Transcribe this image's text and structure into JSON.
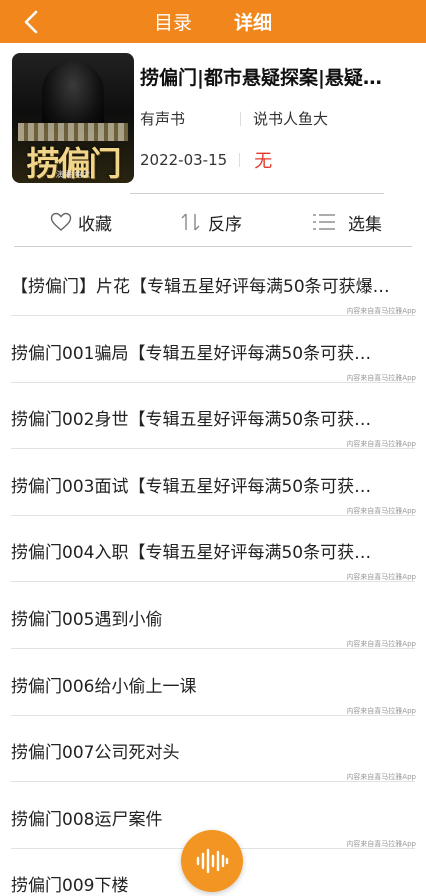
{
  "header": {
    "tabs": [
      "目录",
      "详细"
    ],
    "active_tab": "详细",
    "back_icon": "back-chevron-icon",
    "color": "#f0861c"
  },
  "book": {
    "title": "捞偏门|都市悬疑探案|悬疑…",
    "cover_text": "捞偏门",
    "cover_sub": "演播 鱼大",
    "type": "有声书",
    "narrator": "说书人鱼大",
    "date": "2022-03-15",
    "status": "无"
  },
  "actions": {
    "favorite": "收藏",
    "reverse": "反序",
    "select": "选集"
  },
  "episodes": [
    {
      "title": "【捞偏门】片花【专辑五星好评每满50条可获爆…",
      "source": "内容来自喜马拉雅App"
    },
    {
      "title": "捞偏门001骗局【专辑五星好评每满50条可获…",
      "source": "内容来自喜马拉雅App"
    },
    {
      "title": "捞偏门002身世【专辑五星好评每满50条可获…",
      "source": "内容来自喜马拉雅App"
    },
    {
      "title": "捞偏门003面试【专辑五星好评每满50条可获…",
      "source": "内容来自喜马拉雅App"
    },
    {
      "title": "捞偏门004入职【专辑五星好评每满50条可获…",
      "source": "内容来自喜马拉雅App"
    },
    {
      "title": "捞偏门005遇到小偷",
      "source": "内容来自喜马拉雅App"
    },
    {
      "title": "捞偏门006给小偷上一课",
      "source": "内容来自喜马拉雅App"
    },
    {
      "title": "捞偏门007公司死对头",
      "source": "内容来自喜马拉雅App"
    },
    {
      "title": "捞偏门008运尸案件",
      "source": "内容来自喜马拉雅App"
    },
    {
      "title": "捞偏门009下楼",
      "source": ""
    }
  ],
  "player": {
    "icon": "audio-wave-icon",
    "color": "#f29522"
  }
}
